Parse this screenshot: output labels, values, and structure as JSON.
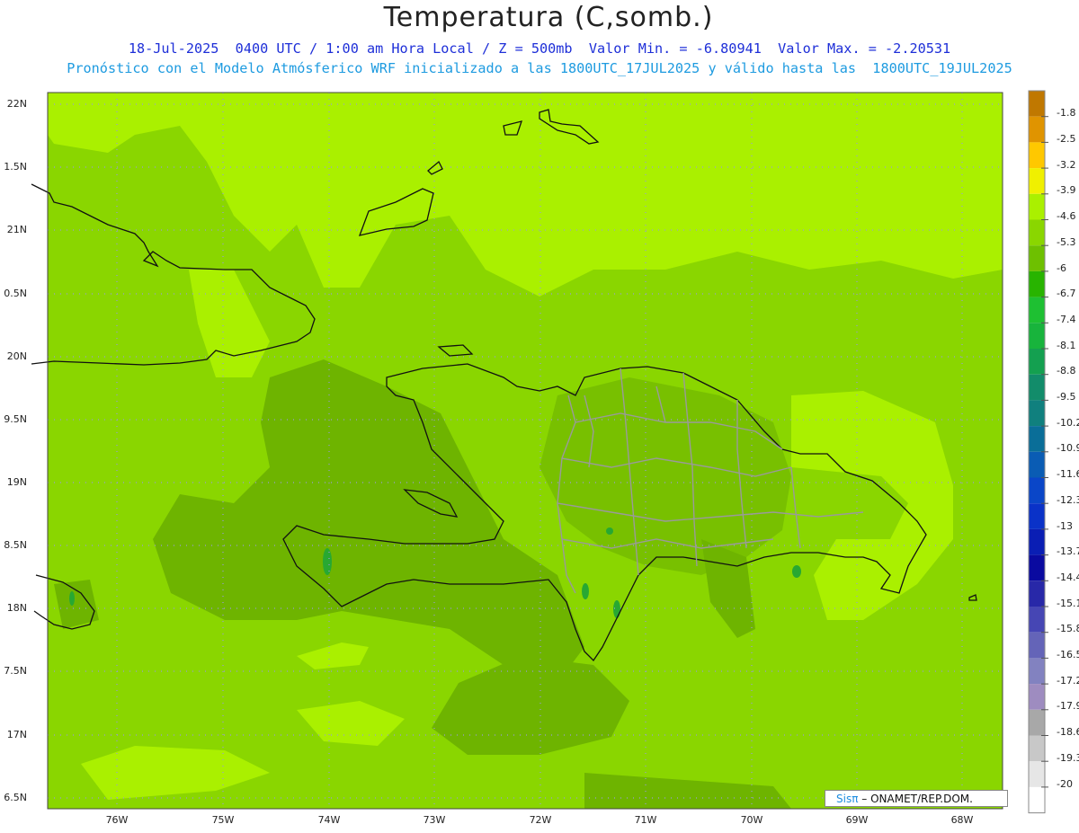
{
  "title": "Temperatura (C,somb.)",
  "subtitle_line1": "18-Jul-2025  0400 UTC / 1:00 am Hora Local / Z = 500mb  Valor Min. = -6.80941  Valor Max. = -2.20531",
  "subtitle_line2": "Pronóstico con el Modelo Atmósferico WRF inicializado a las 1800UTC_17JUL2025 y válido hasta las  1800UTC_19JUL2025",
  "lat_labels": [
    "22N",
    "1.5N",
    "21N",
    "0.5N",
    "20N",
    "9.5N",
    "19N",
    "8.5N",
    "18N",
    "7.5N",
    "17N",
    "6.5N"
  ],
  "lon_labels": [
    "76W",
    "75W",
    "74W",
    "73W",
    "72W",
    "71W",
    "70W",
    "69W",
    "68W"
  ],
  "colorbar": {
    "labels": [
      "-1.8",
      "-2.5",
      "-3.2",
      "-3.9",
      "-4.6",
      "-5.3",
      "-6",
      "-6.7",
      "-7.4",
      "-8.1",
      "-8.8",
      "-9.5",
      "-10.2",
      "-10.9",
      "-11.6",
      "-12.3",
      "-13",
      "-13.7",
      "-14.4",
      "-15.1",
      "-15.8",
      "-16.5",
      "-17.2",
      "-17.9",
      "-18.6",
      "-19.3",
      "-20"
    ],
    "colors": [
      "#c07800",
      "#e09400",
      "#ffc800",
      "#f0f000",
      "#aaf000",
      "#8ad600",
      "#6ec000",
      "#28b400",
      "#1ec032",
      "#18b43c",
      "#14a050",
      "#128c6a",
      "#10807e",
      "#0a6e98",
      "#0a5cb4",
      "#0a46c8",
      "#0a32c8",
      "#0a1eb4",
      "#0a0aa0",
      "#2828a8",
      "#4646b4",
      "#6464b8",
      "#8282c0",
      "#9e8cc0",
      "#a8a8a8",
      "#c8c8c8",
      "#e6e6e6",
      "#ffffff"
    ]
  },
  "credit": {
    "brand": "Sisπ",
    "text": "– ONAMET/REP.DOM."
  },
  "field_colors": {
    "light": "#aaf000",
    "mid": "#8ad600",
    "dark": "#6eb400",
    "patch": "#28a832"
  }
}
